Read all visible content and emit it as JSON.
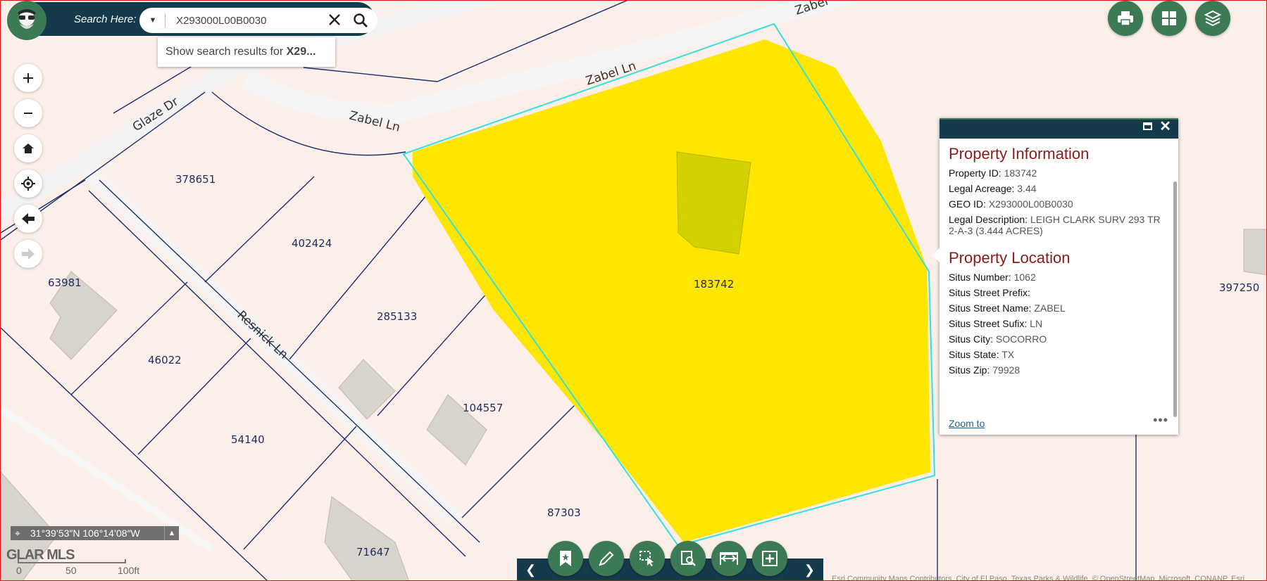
{
  "search": {
    "label": "Search Here:",
    "value": "X293000L00B0030",
    "suggestion_prefix": "Show search results for ",
    "suggestion_term": "X29..."
  },
  "map": {
    "streets": [
      "Zabel Ln",
      "Zabel Ln",
      "Zabel",
      "Glaze Dr",
      "Resnick Ln"
    ],
    "parcels": [
      "378651",
      "402424",
      "285133",
      "104557",
      "183742",
      "397250",
      "63981",
      "46022",
      "54140",
      "87303",
      "71647"
    ]
  },
  "popup": {
    "info_title": "Property Information",
    "info_rows": [
      {
        "k": "Property ID:",
        "v": "183742"
      },
      {
        "k": "Legal Acreage:",
        "v": "3.44"
      },
      {
        "k": "GEO ID:",
        "v": "X293000L00B0030"
      },
      {
        "k": "Legal Description:",
        "v": "LEIGH CLARK SURV 293 TR 2-A-3 (3.444 ACRES)"
      }
    ],
    "location_title": "Property Location",
    "location_rows": [
      {
        "k": "Situs Number:",
        "v": "1062"
      },
      {
        "k": "Situs Street Prefix:",
        "v": ""
      },
      {
        "k": "Situs Street Name:",
        "v": "ZABEL"
      },
      {
        "k": "Situs Street Sufix:",
        "v": "LN"
      },
      {
        "k": "Situs City:",
        "v": "SOCORRO"
      },
      {
        "k": "Situs State:",
        "v": "TX"
      },
      {
        "k": "Situs Zip:",
        "v": "79928"
      }
    ],
    "zoom_link": "Zoom to"
  },
  "coords": "31°39’53″N 106°14’08″W",
  "watermark": "GLAR MLS",
  "scale": {
    "t0": "0",
    "t1": "50",
    "t2": "100ft"
  },
  "attribution": "Esri Community Maps Contributors, City of El Paso, Texas Parks & Wildlife, © OpenStreetMap, Microsoft, CONANP, Esri"
}
